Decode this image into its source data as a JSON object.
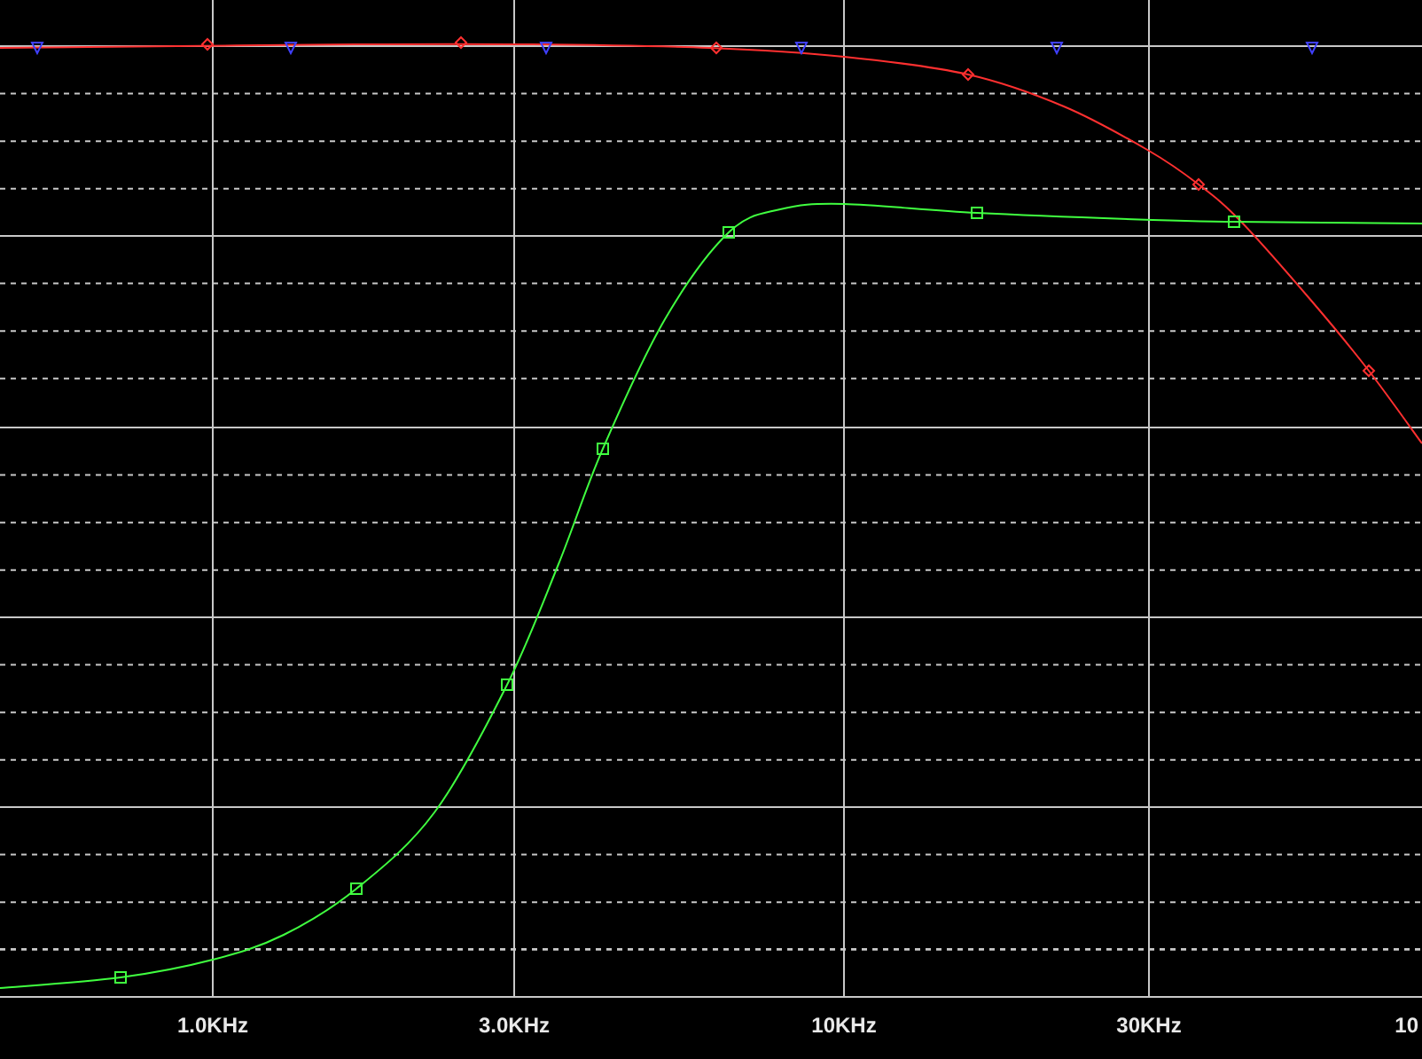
{
  "plot": {
    "x_tick_labels": [
      "1.0KHz",
      "3.0KHz",
      "10KHz",
      "30KHz",
      "10"
    ]
  }
}
